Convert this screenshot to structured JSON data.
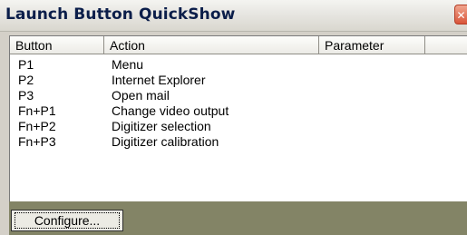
{
  "window": {
    "title": "Launch Button QuickShow",
    "close_glyph": "✕"
  },
  "list": {
    "columns": [
      "Button",
      "Action",
      "Parameter",
      ""
    ],
    "rows": [
      {
        "button": "P1",
        "action": "Menu",
        "parameter": ""
      },
      {
        "button": "P2",
        "action": "Internet Explorer",
        "parameter": ""
      },
      {
        "button": "P3",
        "action": "Open mail",
        "parameter": ""
      },
      {
        "button": "Fn+P1",
        "action": "Change video output",
        "parameter": ""
      },
      {
        "button": "Fn+P2",
        "action": "Digitizer selection",
        "parameter": ""
      },
      {
        "button": "Fn+P3",
        "action": "Digitizer calibration",
        "parameter": ""
      }
    ]
  },
  "footer": {
    "configure_label": "Configure..."
  },
  "colors": {
    "title_text": "#0b1e4a",
    "footer_background": "#838466",
    "close_button": "#d9553a"
  }
}
